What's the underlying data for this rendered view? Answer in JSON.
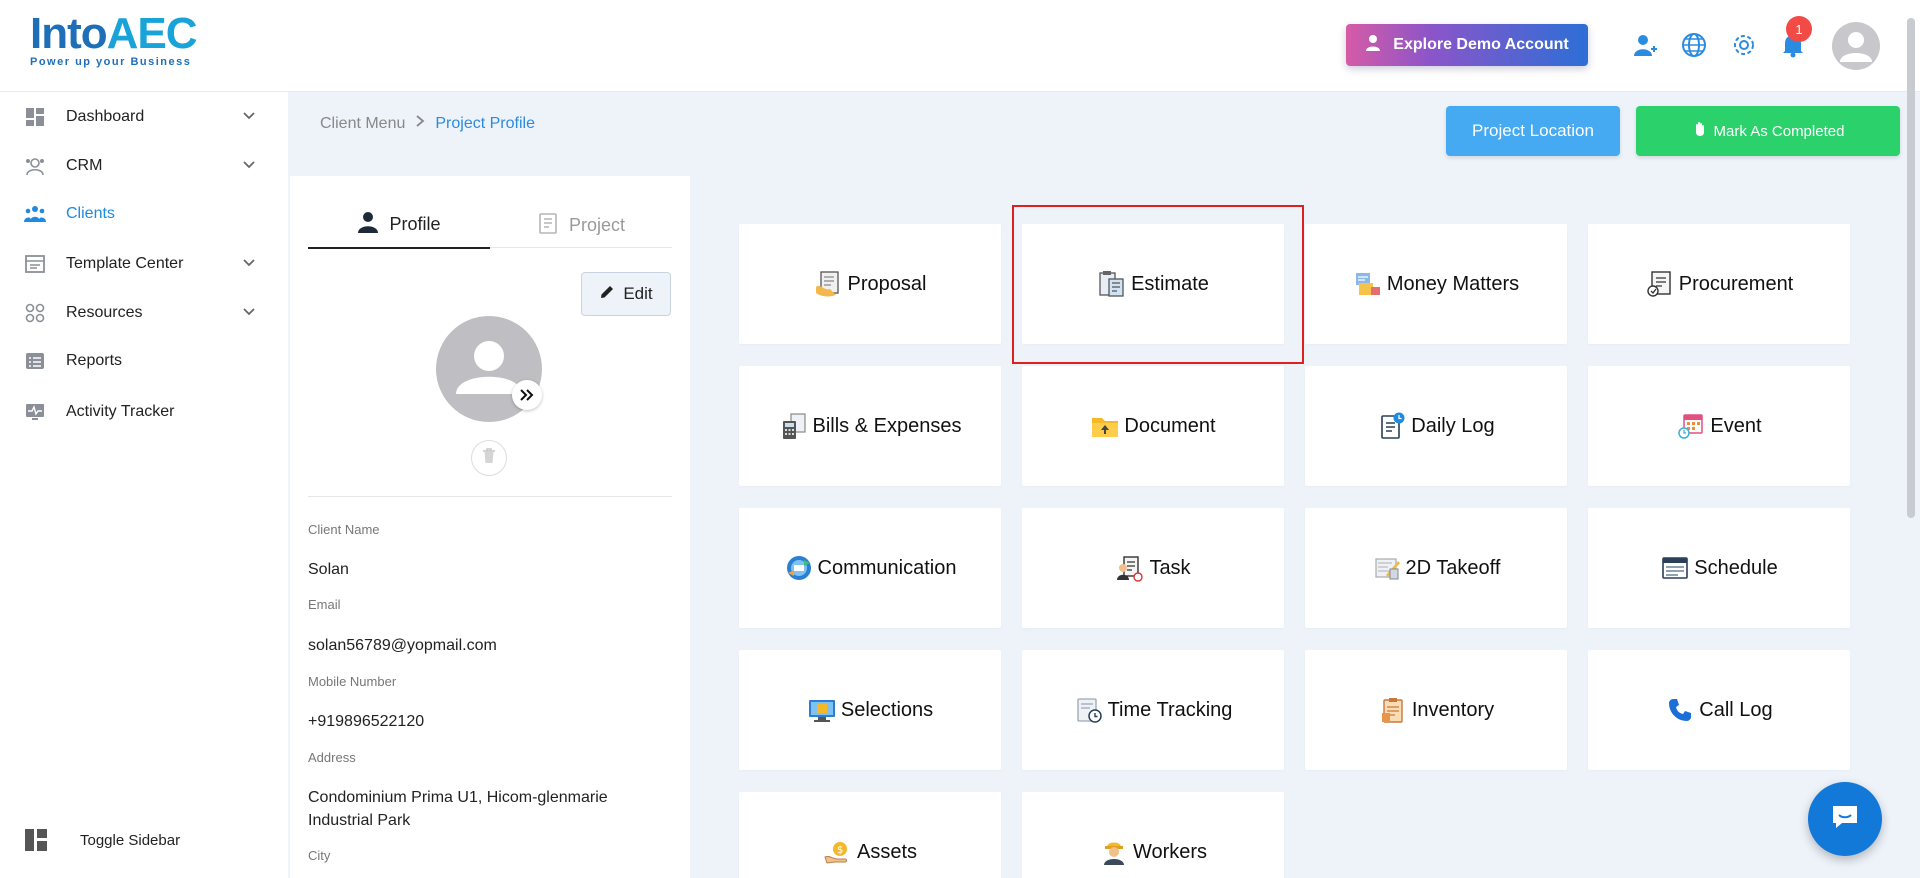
{
  "header": {
    "logo_main": "Into",
    "logo_accent": "AEC",
    "logo_tagline": "Power up your Business",
    "demo_button": "Explore Demo Account",
    "notification_count": "1",
    "icons": [
      "add-user-icon",
      "globe-icon",
      "gear-icon",
      "bell-icon",
      "user-avatar"
    ]
  },
  "sidebar": {
    "items": [
      {
        "label": "Dashboard",
        "icon": "dashboard-icon",
        "expandable": true
      },
      {
        "label": "CRM",
        "icon": "crm-icon",
        "expandable": true
      },
      {
        "label": "Clients",
        "icon": "clients-icon",
        "active": true
      },
      {
        "label": "Template Center",
        "icon": "template-icon",
        "expandable": true
      },
      {
        "label": "Resources",
        "icon": "resources-icon",
        "expandable": true
      },
      {
        "label": "Reports",
        "icon": "reports-icon"
      },
      {
        "label": "Activity Tracker",
        "icon": "activity-icon"
      }
    ],
    "toggle_label": "Toggle Sidebar"
  },
  "breadcrumb": {
    "parent": "Client Menu",
    "current": "Project Profile"
  },
  "actions": {
    "project_location": "Project Location",
    "mark_completed": "Mark As Completed"
  },
  "profile": {
    "tabs": [
      "Profile",
      "Project"
    ],
    "active_tab": "Profile",
    "edit_label": "Edit",
    "fields": [
      {
        "label": "Client Name",
        "value": "Solan"
      },
      {
        "label": "Email",
        "value": "solan56789@yopmail.com"
      },
      {
        "label": "Mobile Number",
        "value": "+919896522120"
      },
      {
        "label": "Address",
        "value": "Condominium Prima U1, Hicom-glenmarie Industrial Park"
      },
      {
        "label": "City",
        "value": ""
      }
    ]
  },
  "tiles": [
    {
      "label": "Proposal",
      "icon": "proposal-icon"
    },
    {
      "label": "Estimate",
      "icon": "estimate-icon",
      "highlighted": true
    },
    {
      "label": "Money Matters",
      "icon": "money-matters-icon"
    },
    {
      "label": "Procurement",
      "icon": "procurement-icon"
    },
    {
      "label": "Bills & Expenses",
      "icon": "bills-icon"
    },
    {
      "label": "Document",
      "icon": "document-icon"
    },
    {
      "label": "Daily Log",
      "icon": "daily-log-icon"
    },
    {
      "label": "Event",
      "icon": "event-icon"
    },
    {
      "label": "Communication",
      "icon": "communication-icon"
    },
    {
      "label": "Task",
      "icon": "task-icon"
    },
    {
      "label": "2D Takeoff",
      "icon": "takeoff-icon"
    },
    {
      "label": "Schedule",
      "icon": "schedule-icon"
    },
    {
      "label": "Selections",
      "icon": "selections-icon"
    },
    {
      "label": "Time Tracking",
      "icon": "time-tracking-icon"
    },
    {
      "label": "Inventory",
      "icon": "inventory-icon"
    },
    {
      "label": "Call Log",
      "icon": "phone-icon"
    },
    {
      "label": "Assets",
      "icon": "assets-icon"
    },
    {
      "label": "Workers",
      "icon": "workers-icon"
    }
  ],
  "colors": {
    "primary_blue": "#45aaf2",
    "success_green": "#2bd16b",
    "active_nav": "#1d8be0",
    "highlight_red": "#e02020",
    "background": "#eef3fa"
  }
}
